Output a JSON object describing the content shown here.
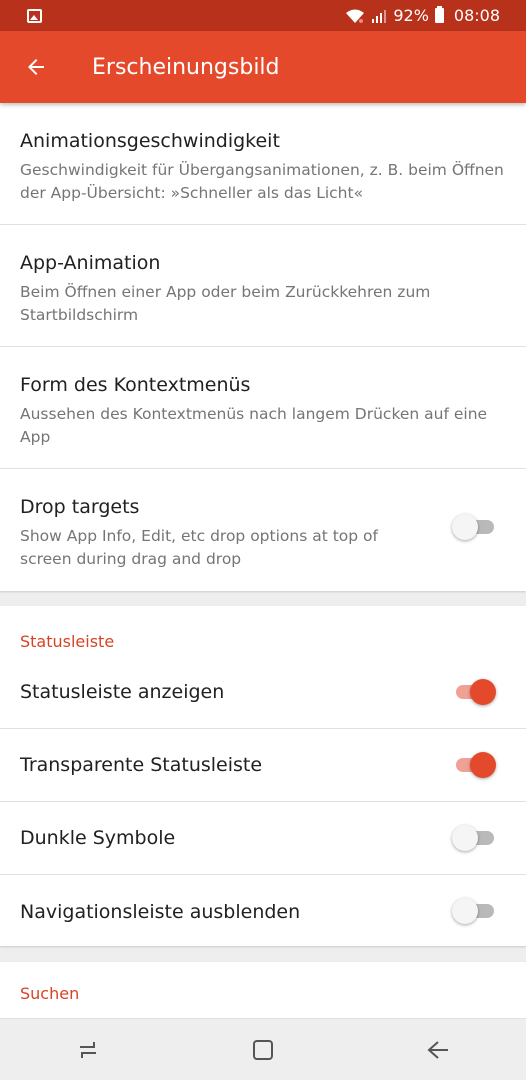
{
  "status_bar": {
    "battery": "92%",
    "time": "08:08",
    "icons": [
      "image-icon",
      "wifi-icon",
      "signal-icon",
      "battery-icon"
    ]
  },
  "app_bar": {
    "title": "Erscheinungsbild",
    "back_icon": "arrow-left-icon"
  },
  "colors": {
    "status_bar": "#b8311b",
    "app_bar": "#e4492c",
    "accent": "#d84325"
  },
  "settings": [
    {
      "title": "Animationsgeschwindigkeit",
      "subtitle": "Geschwindigkeit für Übergangsanimationen, z. B. beim Öffnen der App-Übersicht: »Schneller als das Licht«"
    },
    {
      "title": "App-Animation",
      "subtitle": "Beim Öffnen einer App oder beim Zurückkehren zum Startbildschirm"
    },
    {
      "title": "Form des Kontextmenüs",
      "subtitle": "Aussehen des Kontextmenüs nach langem Drücken auf eine App"
    },
    {
      "title": "Drop targets",
      "subtitle": "Show App Info, Edit, etc drop options at top of screen during drag and drop",
      "toggle": false
    }
  ],
  "statusleiste_section": {
    "header": "Statusleiste",
    "items": [
      {
        "title": "Statusleiste anzeigen",
        "toggle": true
      },
      {
        "title": "Transparente Statusleiste",
        "toggle": true
      },
      {
        "title": "Dunkle Symbole",
        "toggle": false
      },
      {
        "title": "Navigationsleiste ausblenden",
        "toggle": false
      }
    ]
  },
  "suchen_section": {
    "header": "Suchen"
  },
  "nav_bar": [
    "recent-apps-icon",
    "home-icon",
    "back-icon"
  ]
}
